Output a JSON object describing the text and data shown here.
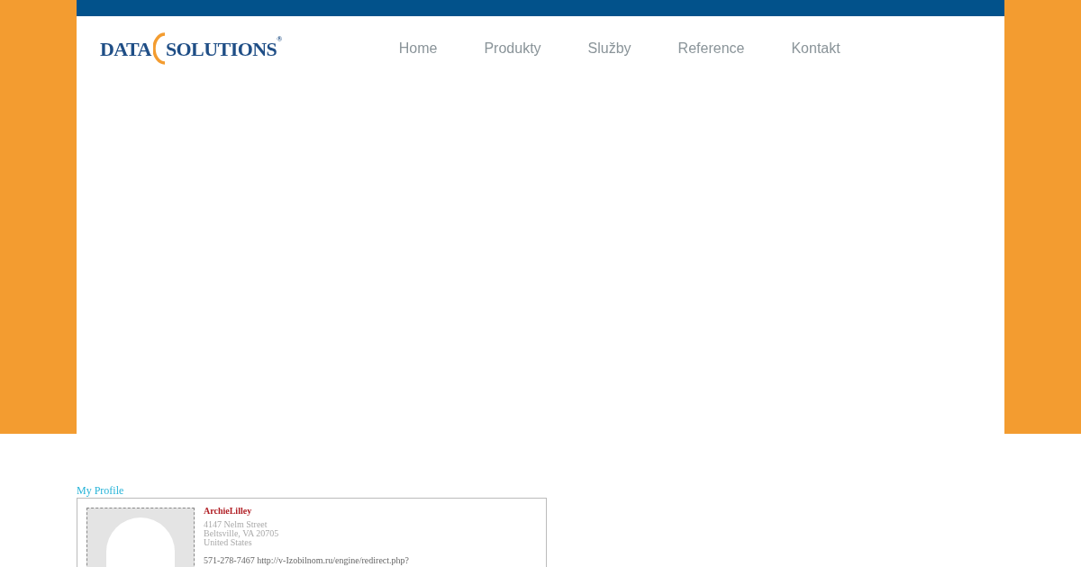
{
  "logo": {
    "left": "DATA",
    "right": "SOLUTIONS",
    "mark": "®"
  },
  "nav": [
    {
      "label": "Home"
    },
    {
      "label": "Produkty"
    },
    {
      "label": "Služby"
    },
    {
      "label": "Reference"
    },
    {
      "label": "Kontakt"
    }
  ],
  "profile": {
    "heading": "My Profile",
    "name": "ArchieLilley",
    "address": [
      "4147 Nelm Street",
      "Beltsville, VA 20705",
      "United States"
    ],
    "contact": "571-278-7467 http://v-Izobilnom.ru/engine/redirect.php?"
  }
}
